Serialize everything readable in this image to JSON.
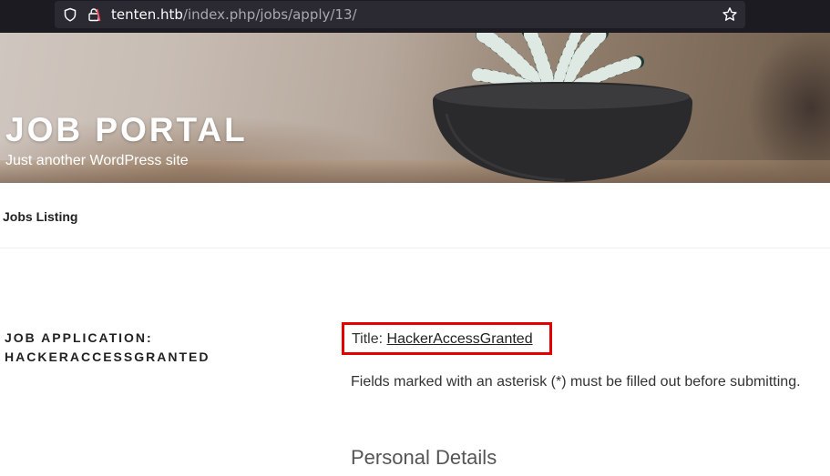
{
  "browser": {
    "url_host": "tenten.htb",
    "url_path": "/index.php/jobs/apply/13/",
    "icons": {
      "shield": "shield-icon",
      "lock": "lock-icon",
      "bookmark": "star-icon"
    }
  },
  "site": {
    "title": "JOB PORTAL",
    "tagline": "Just another WordPress site"
  },
  "nav": {
    "items": [
      {
        "label": "Jobs Listing"
      }
    ]
  },
  "content": {
    "entry_title": "JOB APPLICATION: HACKERACCESSGRANTED",
    "job_title_prefix": "Title: ",
    "job_title_value": "HackerAccessGranted",
    "fields_note": "Fields marked with an asterisk (*) must be filled out before submitting.",
    "section_heading": "Personal Details"
  },
  "colors": {
    "highlight_border": "#e50000",
    "browser_bg": "#1c1b22",
    "url_box_bg": "#2b2a33"
  }
}
